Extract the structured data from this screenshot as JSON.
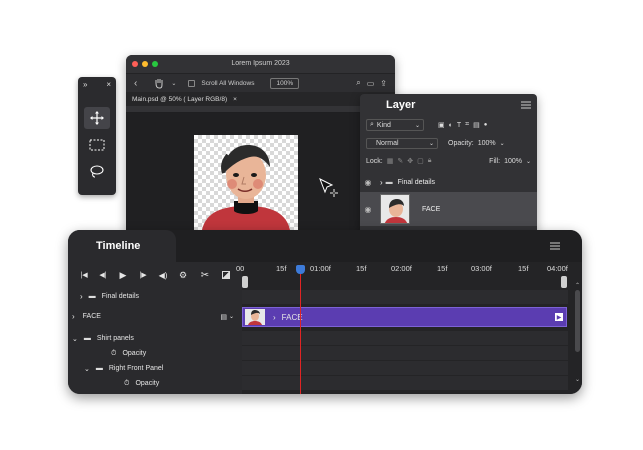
{
  "tools_panel": {
    "expand_label": "»",
    "close_label": "×",
    "tools": [
      "move-tool",
      "marquee-tool",
      "lasso-tool"
    ]
  },
  "main_window": {
    "title": "Lorem Ipsum 2023",
    "scroll_all_label": "Scroll All Windows",
    "zoom_value": "100%",
    "doc_tab_label": "Main.psd @ 50% ( Layer RGB/8)",
    "doc_tab_close": "×"
  },
  "layer_panel": {
    "title": "Layer",
    "filter_kind": "Kind",
    "blend_mode": "Normal",
    "opacity_label": "Opacity:",
    "opacity_value": "100%",
    "lock_label": "Lock:",
    "fill_label": "Fill:",
    "fill_value": "100%",
    "layers": [
      {
        "name": "Final details",
        "type": "group"
      },
      {
        "name": "FACE",
        "type": "layer"
      }
    ]
  },
  "timeline": {
    "title": "Timeline",
    "ruler": [
      "00",
      "15f",
      "01:00f",
      "15f",
      "02:00f",
      "15f",
      "03:00f",
      "15f",
      "04:00f"
    ],
    "tracks": [
      {
        "name": "Final details"
      },
      {
        "name": "FACE"
      },
      {
        "name": "Shirt panels"
      },
      {
        "name": "Opacity"
      },
      {
        "name": "Right Front Panel"
      },
      {
        "name": "Opacity"
      }
    ],
    "clip_label": "FACE"
  },
  "colors": {
    "accent_clip": "#5b3db1",
    "playhead": "#e02424",
    "playhead_knob": "#3d7bd9"
  }
}
